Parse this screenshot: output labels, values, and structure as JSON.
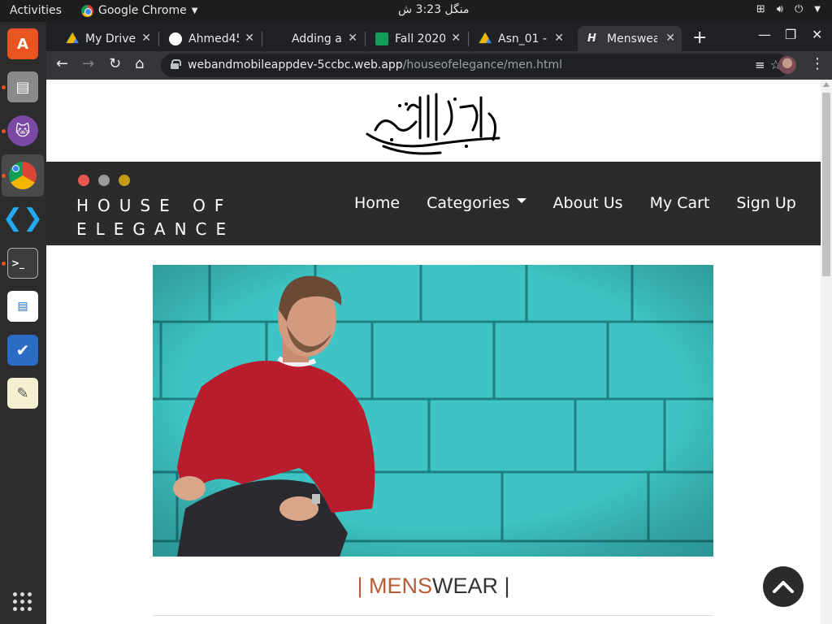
{
  "system_bar": {
    "activities": "Activities",
    "app_name": "Google Chrome",
    "clock": "منگل 3:23 ش"
  },
  "browser": {
    "tabs": [
      {
        "label": "My Drive",
        "icon": "google-drive-icon"
      },
      {
        "label": "Ahmed45",
        "icon": "github-icon"
      },
      {
        "label": "Adding a",
        "icon": "blank-icon"
      },
      {
        "label": "Fall 2020",
        "icon": "google-sheets-icon"
      },
      {
        "label": "Asn_01 -",
        "icon": "google-drive-icon"
      },
      {
        "label": "Menswea",
        "icon": "site-icon",
        "active": true
      }
    ],
    "url_domain": "webandmobileappdev-5ccbc.web.app",
    "url_path": "/houseofelegance/men.html"
  },
  "site": {
    "brand_line1": "HOUSE OF",
    "brand_line2": "ELEGANCE",
    "nav": {
      "home": "Home",
      "categories": "Categories",
      "about": "About Us",
      "cart": "My Cart",
      "signup": "Sign Up"
    },
    "dot_colors": [
      "#e9574f",
      "#9a9a9a",
      "#c49a17"
    ],
    "heading_bar_left": "|",
    "heading_accent": "MENS",
    "heading_rest": "WEAR",
    "heading_bar_right": "|"
  },
  "colors": {
    "accent": "#b65c37",
    "navbar_bg": "#2b2b2b",
    "ubuntu_orange": "#e95420"
  }
}
